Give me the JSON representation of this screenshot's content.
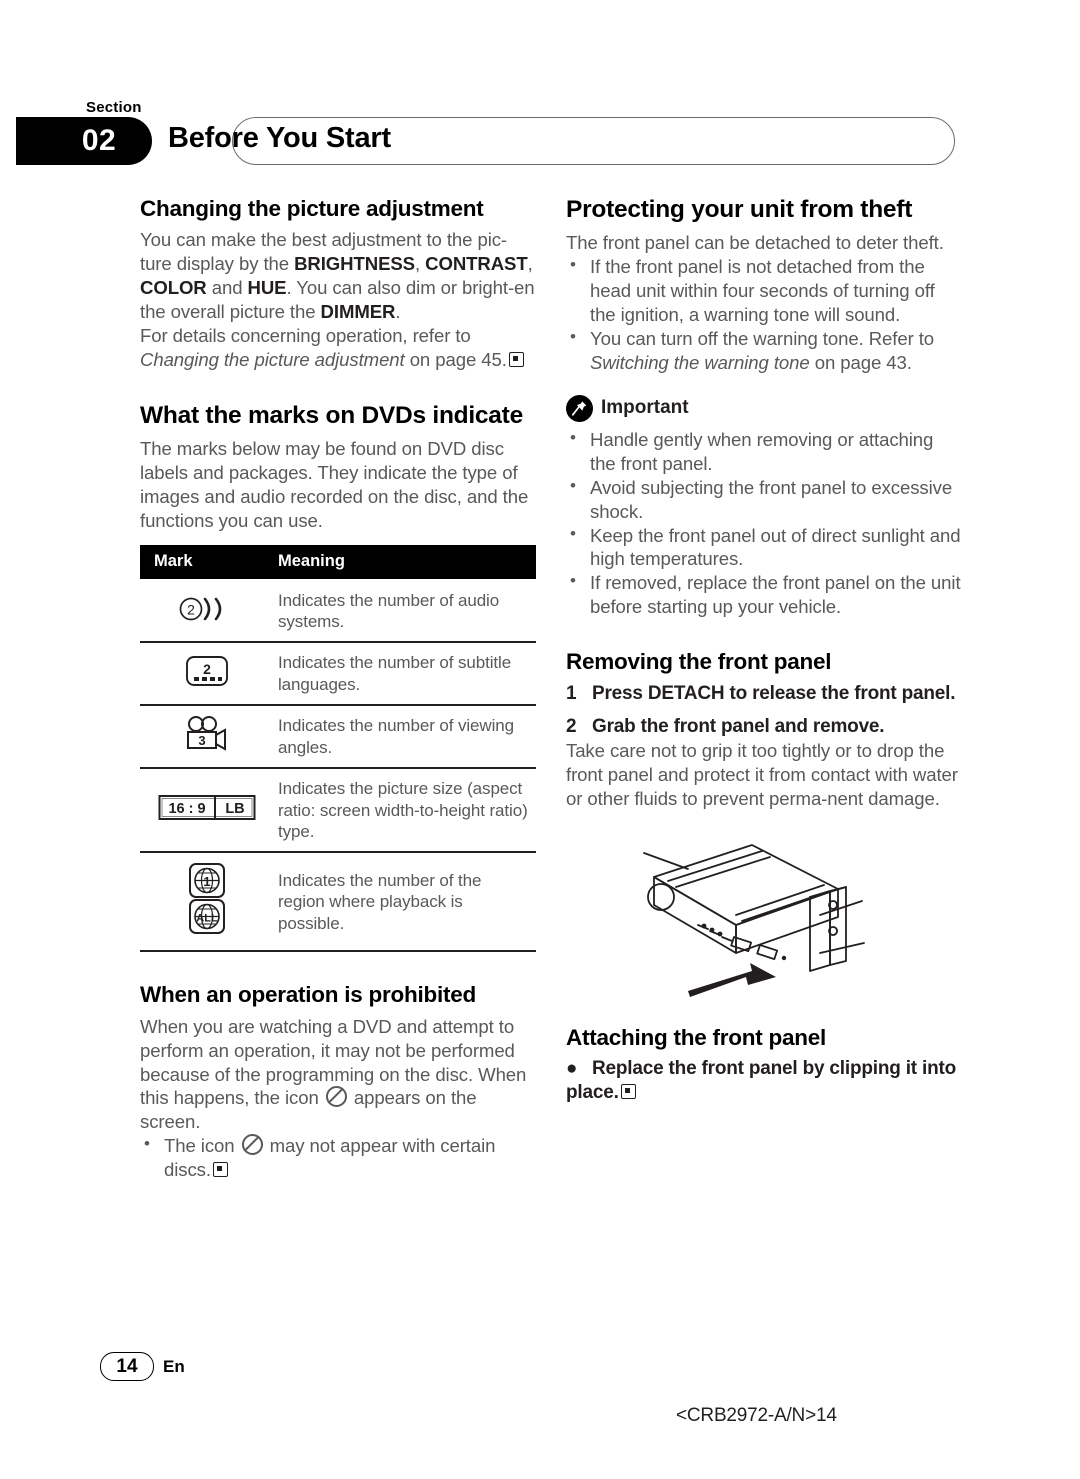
{
  "header": {
    "section_word": "Section",
    "section_number": "02",
    "title": "Before You Start"
  },
  "left_column": {
    "changing_picture": {
      "heading": "Changing the picture adjustment",
      "para_1_part_1": "You can make the best adjustment to the pic-ture display by the ",
      "term_brightness": "BRIGHTNESS",
      "sep_1": ", ",
      "term_contrast": "CONTRAST",
      "sep_2": ", ",
      "term_color": "COLOR",
      "sep_3": " and ",
      "term_hue": "HUE",
      "para_1_part_2": ". You can also dim or bright-en the overall picture the ",
      "term_dimmer": "DIMMER",
      "para_1_part_3": ".",
      "para_2_lead": "For details concerning operation, refer to ",
      "para_2_italic": "Changing the picture adjustment",
      "para_2_tail": " on page 45."
    },
    "dvd_marks": {
      "heading": "What the marks on DVDs indicate",
      "intro": "The marks below may be found on DVD disc labels and packages. They indicate the type of images and audio recorded on the disc, and the functions you can use.",
      "table": {
        "columns": [
          "Mark",
          "Meaning"
        ],
        "rows": [
          {
            "icon": "audio-systems-icon",
            "icon_value": "2",
            "meaning": "Indicates the number of audio systems."
          },
          {
            "icon": "subtitle-languages-icon",
            "icon_value": "2",
            "meaning": "Indicates the number of subtitle languages."
          },
          {
            "icon": "viewing-angles-icon",
            "icon_value": "3",
            "meaning": "Indicates the number of viewing angles."
          },
          {
            "icon": "aspect-ratio-icon",
            "icon_value": "16 : 9",
            "icon_value2": "LB",
            "meaning": "Indicates the picture size (aspect ratio: screen width-to-height ratio) type."
          },
          {
            "icon": "region-code-icon",
            "icon_value": "1",
            "icon_value2": "ALL",
            "meaning": "Indicates the number of the region where playback is possible."
          }
        ]
      }
    },
    "operation_prohibited": {
      "heading": "When an operation is prohibited",
      "para_part_1": "When you are watching a DVD and attempt to perform an operation, it may not be performed because of the programming on the disc. When this happens, the icon ",
      "para_part_2": " appears on the screen.",
      "bullet_part_1": "The icon ",
      "bullet_part_2": " may not appear with certain discs."
    }
  },
  "right_column": {
    "protecting_theft": {
      "heading": "Protecting your unit from theft",
      "intro": "The front panel can be detached to deter theft.",
      "bullets": [
        {
          "text": "If the front panel is not detached from the head unit within four seconds of turning off the ignition, a warning tone will sound."
        }
      ],
      "bullet_2_lead": "You can turn off the warning tone. Refer to ",
      "bullet_2_italic": "Switching the warning tone",
      "bullet_2_tail": " on page 43."
    },
    "important": {
      "icon": "pushpin-icon",
      "label": "Important",
      "bullets": [
        "Handle gently when removing or attaching the front panel.",
        "Avoid subjecting the front panel to excessive shock.",
        "Keep the front panel out of direct sunlight and high temperatures.",
        "If removed, replace the front panel on the unit before starting up your vehicle."
      ]
    },
    "removing_panel": {
      "heading": "Removing the front panel",
      "step_1_num": "1",
      "step_1_text": "Press DETACH to release the front panel.",
      "step_2_num": "2",
      "step_2_text": "Grab the front panel and remove.",
      "step_2_body": "Take care not to grip it too tightly or to drop the front panel and protect it from contact with water or other fluids to prevent perma-nent damage.",
      "illustration": "head-unit-detach-illustration"
    },
    "attaching_panel": {
      "heading": "Attaching the front panel",
      "bullet_marker": "●",
      "bullet_text": "Replace the front panel by clipping it into place."
    }
  },
  "footer": {
    "page_number": "14",
    "language": "En",
    "part_code": "<CRB2972-A/N>14"
  }
}
